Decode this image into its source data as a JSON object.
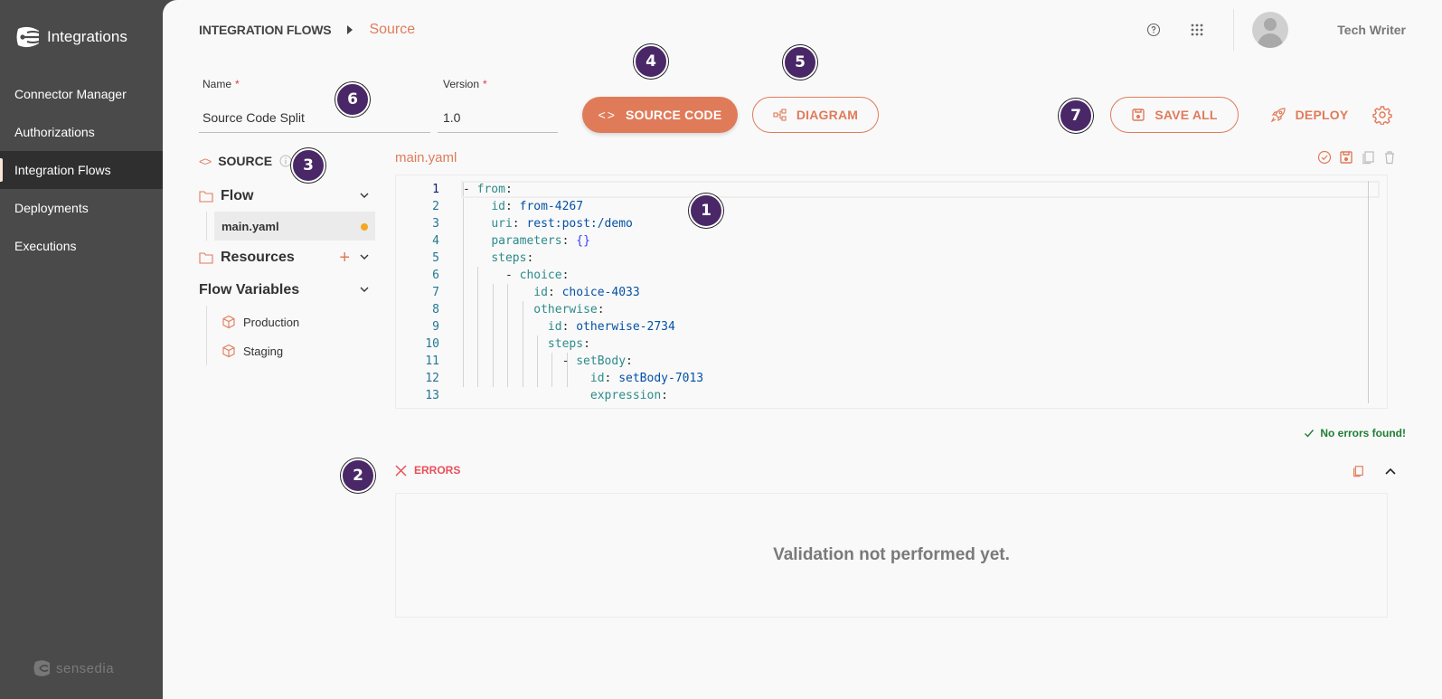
{
  "app": {
    "name": "Integrations",
    "brand": "sensedia"
  },
  "sidebar": {
    "items": [
      {
        "label": "Connector Manager",
        "active": false
      },
      {
        "label": "Authorizations",
        "active": false
      },
      {
        "label": "Integration Flows",
        "active": true
      },
      {
        "label": "Deployments",
        "active": false
      },
      {
        "label": "Executions",
        "active": false
      }
    ]
  },
  "header": {
    "breadcrumb_root": "INTEGRATION FLOWS",
    "breadcrumb_current": "Source",
    "help_icon": "help-circle-icon",
    "apps_icon": "grid-apps-icon",
    "username": "Tech Writer"
  },
  "form": {
    "name_label": "Name",
    "name_value": "Source Code Split",
    "version_label": "Version",
    "version_value": "1.0",
    "required_mark": "*"
  },
  "toolbar": {
    "source_code_label": "SOURCE CODE",
    "diagram_label": "DIAGRAM",
    "save_all_label": "SAVE ALL",
    "deploy_label": "DEPLOY"
  },
  "tree": {
    "header": "SOURCE",
    "flow_label": "Flow",
    "files": [
      {
        "name": "main.yaml",
        "modified": true
      }
    ],
    "resources_label": "Resources",
    "flow_variables_label": "Flow Variables",
    "variables": [
      {
        "name": "Production"
      },
      {
        "name": "Staging"
      }
    ]
  },
  "editor": {
    "filename": "main.yaml",
    "current_line": 1,
    "lines": [
      {
        "n": "1",
        "indent": "",
        "dash": "- ",
        "key": "from",
        "val": ""
      },
      {
        "n": "2",
        "indent": "    ",
        "dash": "",
        "key": "id",
        "val": "from-4267"
      },
      {
        "n": "3",
        "indent": "    ",
        "dash": "",
        "key": "uri",
        "val": "rest:post:/demo"
      },
      {
        "n": "4",
        "indent": "    ",
        "dash": "",
        "key": "parameters",
        "val": "{}"
      },
      {
        "n": "5",
        "indent": "    ",
        "dash": "",
        "key": "steps",
        "val": ""
      },
      {
        "n": "6",
        "indent": "      ",
        "dash": "- ",
        "key": "choice",
        "val": ""
      },
      {
        "n": "7",
        "indent": "          ",
        "dash": "",
        "key": "id",
        "val": "choice-4033"
      },
      {
        "n": "8",
        "indent": "          ",
        "dash": "",
        "key": "otherwise",
        "val": ""
      },
      {
        "n": "9",
        "indent": "            ",
        "dash": "",
        "key": "id",
        "val": "otherwise-2734"
      },
      {
        "n": "10",
        "indent": "            ",
        "dash": "",
        "key": "steps",
        "val": ""
      },
      {
        "n": "11",
        "indent": "              ",
        "dash": "- ",
        "key": "setBody",
        "val": ""
      },
      {
        "n": "12",
        "indent": "                  ",
        "dash": "",
        "key": "id",
        "val": "setBody-7013"
      },
      {
        "n": "13",
        "indent": "                  ",
        "dash": "",
        "key": "expression",
        "val": ""
      }
    ]
  },
  "status": {
    "no_errors": "No errors found!"
  },
  "errors": {
    "title": "ERRORS",
    "message": "Validation not performed yet."
  },
  "callouts": [
    "1",
    "2",
    "3",
    "4",
    "5",
    "6",
    "7"
  ],
  "colors": {
    "accent": "#e07b5a",
    "sidebar": "#4a4a4a",
    "callout": "#4a2868",
    "error": "#e8505b",
    "success": "#1e7e34"
  }
}
